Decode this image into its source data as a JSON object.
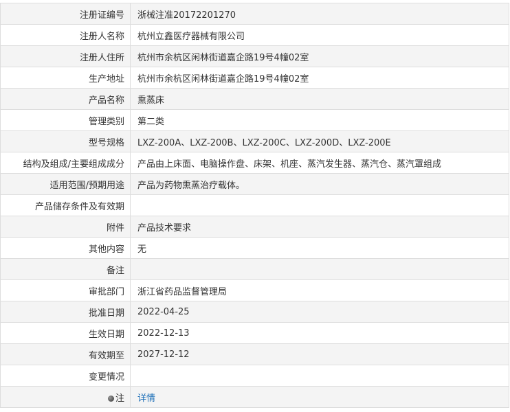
{
  "rows": [
    {
      "label": "注册证编号",
      "value": "浙械注准20172201270"
    },
    {
      "label": "注册人名称",
      "value": "杭州立鑫医疗器械有限公司"
    },
    {
      "label": "注册人住所",
      "value": "杭州市余杭区闲林街道嘉企路19号4幢02室"
    },
    {
      "label": "生产地址",
      "value": "杭州市余杭区闲林街道嘉企路19号4幢02室"
    },
    {
      "label": "产品名称",
      "value": "熏蒸床"
    },
    {
      "label": "管理类别",
      "value": "第二类"
    },
    {
      "label": "型号规格",
      "value": "LXZ-200A、LXZ-200B、LXZ-200C、LXZ-200D、LXZ-200E"
    },
    {
      "label": "结构及组成/主要组成成分",
      "value": "产品由上床面、电脑操作盘、床架、机座、蒸汽发生器、蒸汽仓、蒸汽罩组成"
    },
    {
      "label": "适用范围/预期用途",
      "value": "产品为药物熏蒸治疗载体。"
    },
    {
      "label": "产品储存条件及有效期",
      "value": ""
    },
    {
      "label": "附件",
      "value": "产品技术要求"
    },
    {
      "label": "其他内容",
      "value": "无"
    },
    {
      "label": "备注",
      "value": ""
    },
    {
      "label": "审批部门",
      "value": "浙江省药品监督管理局"
    },
    {
      "label": "批准日期",
      "value": "2022-04-25"
    },
    {
      "label": "生效日期",
      "value": "2022-12-13"
    },
    {
      "label": "有效期至",
      "value": "2027-12-12"
    },
    {
      "label": "变更情况",
      "value": ""
    }
  ],
  "note": {
    "label": "注",
    "icon": "note-icon",
    "link_text": "详情"
  },
  "colors": {
    "alt_row_bg": "#f4f4f4",
    "border": "#dddddd",
    "text": "#333333",
    "link": "#1d6fb8"
  }
}
